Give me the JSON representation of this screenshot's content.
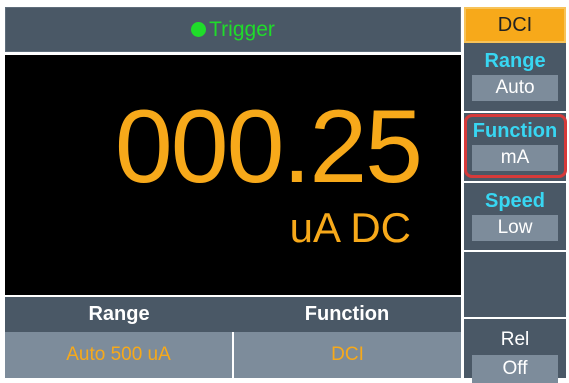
{
  "header": {
    "trigger_label": "Trigger"
  },
  "display": {
    "reading": "000.25",
    "unit": "uA DC"
  },
  "bottom": {
    "labels": [
      "Range",
      "Function"
    ],
    "values": [
      "Auto 500 uA",
      "DCI"
    ]
  },
  "softkeys": {
    "mode_tab": "DCI",
    "range": {
      "label": "Range",
      "value": "Auto"
    },
    "function": {
      "label": "Function",
      "value": "mA"
    },
    "speed": {
      "label": "Speed",
      "value": "Low"
    },
    "rel": {
      "label": "Rel",
      "value": "Off"
    }
  },
  "colors": {
    "accent": "#f7a91a",
    "trigger": "#1fdc2a",
    "softkey_label": "#38d6f2",
    "panel": "#4a5866",
    "value_box": "#7d8c9b",
    "highlight": "#d63a3a"
  },
  "icons": {
    "trigger_indicator": "green-dot-icon"
  }
}
